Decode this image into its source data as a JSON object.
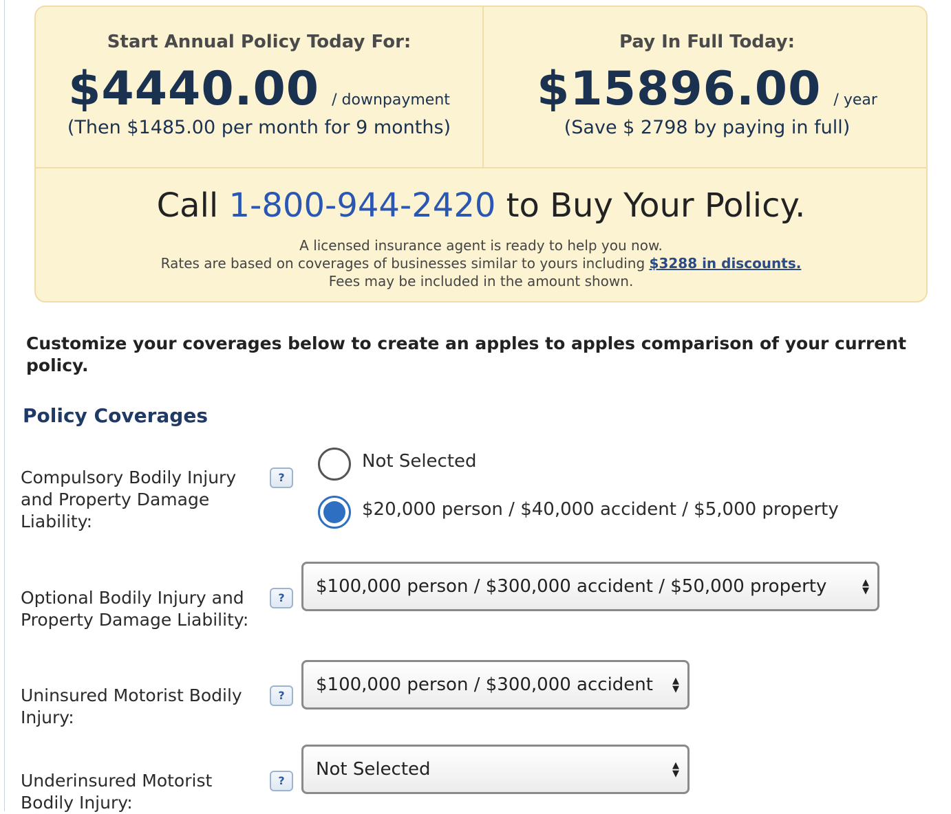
{
  "pricing": {
    "annual": {
      "title": "Start Annual Policy Today For:",
      "price": "$4440.00",
      "unit": "/ downpayment",
      "subtext": "(Then $1485.00  per month for 9  months)"
    },
    "full": {
      "title": "Pay In Full Today:",
      "price": "$15896.00",
      "unit": "/ year",
      "subtext": "(Save $ 2798  by paying in full)"
    },
    "cta": {
      "call": "Call",
      "phone": "1-800-944-2420",
      "tail": "to Buy Your Policy.",
      "line1": "A licensed insurance agent is ready to help you now.",
      "line2_prefix": "Rates are based on coverages of businesses similar to yours including",
      "discount_link": "$3288 in discounts.",
      "line3": "Fees may be included in the amount shown."
    }
  },
  "customize_text": "Customize your coverages below to create an apples to apples comparison of your current policy.",
  "section_title": "Policy Coverages",
  "help_glyph": "?",
  "coverages": {
    "compulsory": {
      "label": "Compulsory Bodily Injury and Property Damage Liability:",
      "options": [
        "Not Selected",
        "$20,000 person / $40,000 accident / $5,000 property"
      ],
      "selected_index": 1
    },
    "optional": {
      "label": "Optional Bodily Injury and Property Damage Liability:",
      "value": "$100,000 person / $300,000 accident / $50,000 property"
    },
    "uninsured": {
      "label": "Uninsured Motorist Bodily Injury:",
      "value": "$100,000 person / $300,000 accident"
    },
    "underinsured": {
      "label": "Underinsured Motorist Bodily Injury:",
      "value": "Not Selected"
    }
  },
  "icons": {
    "help": "question-mark-icon",
    "select_arrows": "up-down-arrows-icon"
  }
}
